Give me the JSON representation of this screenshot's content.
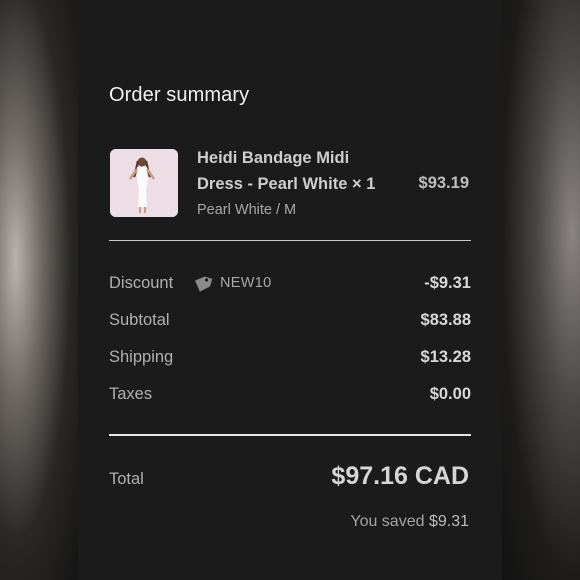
{
  "summary": {
    "title": "Order summary"
  },
  "product": {
    "image_icon": "dress-photo",
    "name": "Heidi Bandage Midi Dress - Pearl White × 1",
    "variant": "Pearl White / M",
    "price": "$93.19"
  },
  "discount": {
    "label": "Discount",
    "icon": "tag-icon",
    "code": "NEW10",
    "value": "-$9.31"
  },
  "subtotal": {
    "label": "Subtotal",
    "value": "$83.88"
  },
  "shipping": {
    "label": "Shipping",
    "value": "$13.28"
  },
  "taxes": {
    "label": "Taxes",
    "value": "$0.00"
  },
  "total": {
    "label": "Total",
    "value": "$97.16 CAD",
    "saved_prefix": "You saved",
    "saved_amount": "$9.31"
  },
  "colors": {
    "panel": "#1b1b1b",
    "text": "#d8d8d8",
    "muted": "#a8a8a8"
  }
}
